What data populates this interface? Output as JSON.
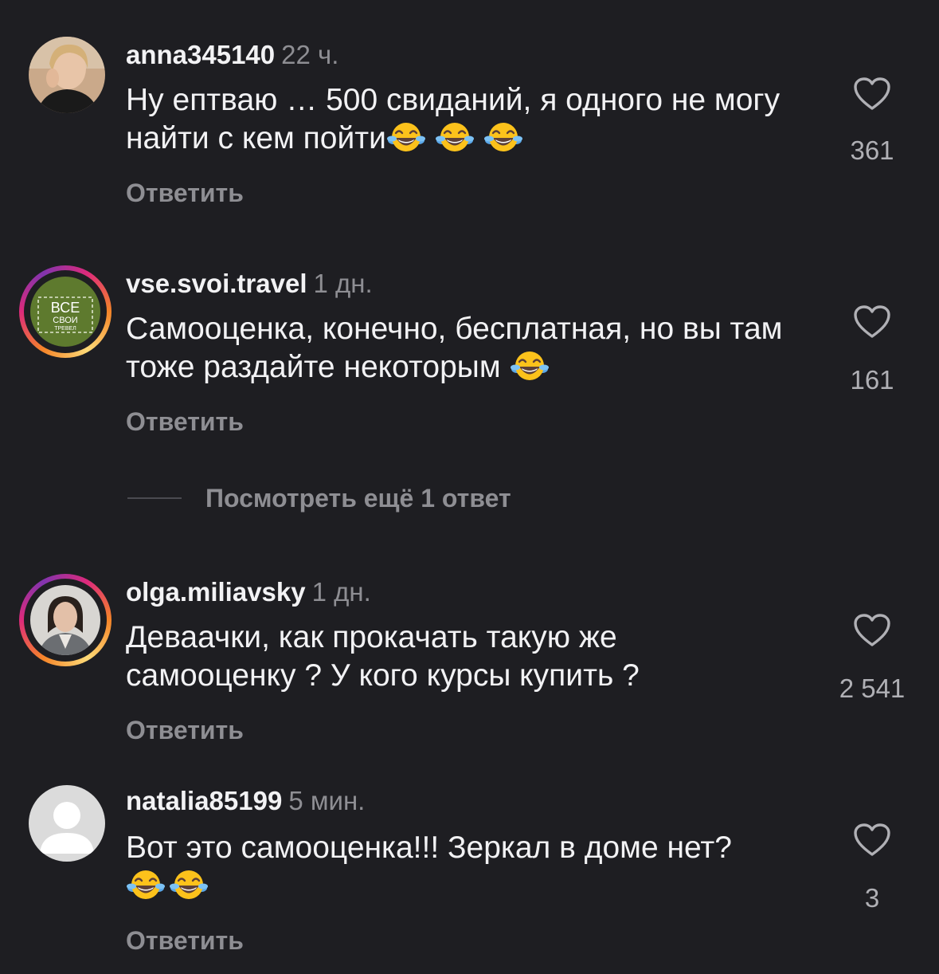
{
  "comments": [
    {
      "username": "anna345140",
      "time": "22 ч.",
      "text": "Ну ептваю … 500 свиданий, я одного не могу найти с кем пойти",
      "emoji_count": 3,
      "likes": "361",
      "reply_label": "Ответить",
      "avatar": "photo"
    },
    {
      "username": "vse.svoi.travel",
      "time": "1 дн.",
      "text": "Самооценка, конечно, бесплатная, но вы там тоже раздайте некоторым",
      "emoji_count": 1,
      "likes": "161",
      "reply_label": "Ответить",
      "avatar": "logo",
      "avatar_logo": {
        "line1": "ВСЕ",
        "line2": "СВОИ",
        "line3": "ТРЕВЕЛ",
        "bg": "#5e7a2e"
      }
    },
    {
      "username": "olga.miliavsky",
      "time": "1 дн.",
      "text": "Деваачки, как прокачать такую же самооценку ? У кого курсы купить ?",
      "emoji_count": 0,
      "likes": "2 541",
      "reply_label": "Ответить",
      "avatar": "photo"
    },
    {
      "username": "natalia85199",
      "time": "5 мин.",
      "text": "Вот это самооценка!!! Зеркал в доме нет?",
      "emoji_count": 2,
      "likes": "3",
      "reply_label": "Ответить",
      "avatar": "default"
    }
  ],
  "view_more_label": "Посмотреть ещё 1 ответ",
  "icons": {
    "like": "heart-icon",
    "emoji": "face-with-tears-of-joy-icon"
  },
  "colors": {
    "background": "#1e1e22",
    "muted": "#8e8e93",
    "text": "#f2f2f4"
  }
}
